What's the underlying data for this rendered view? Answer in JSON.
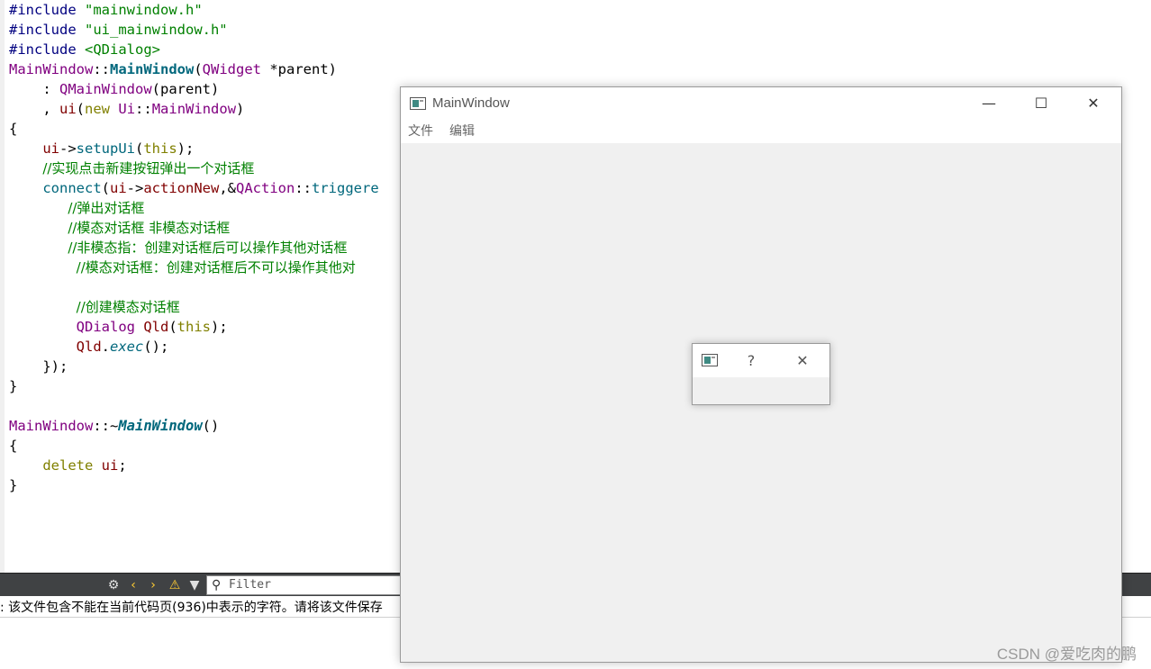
{
  "editor": {
    "lines": [
      [
        [
          "t-pp",
          "#include "
        ],
        [
          "t-str",
          "\"mainwindow.h\""
        ]
      ],
      [
        [
          "t-pp",
          "#include "
        ],
        [
          "t-str",
          "\"ui_mainwindow.h\""
        ]
      ],
      [
        [
          "t-pp",
          "#include "
        ],
        [
          "t-str",
          "<QDialog>"
        ]
      ],
      [
        [
          "t-cls",
          "MainWindow"
        ],
        [
          "t-def",
          "::"
        ],
        [
          "t-fnb",
          "MainWindow"
        ],
        [
          "t-def",
          "("
        ],
        [
          "t-cls",
          "QWidget"
        ],
        [
          "t-def",
          " *parent)"
        ]
      ],
      [
        [
          "t-def",
          "    : "
        ],
        [
          "t-cls",
          "QMainWindow"
        ],
        [
          "t-def",
          "(parent)"
        ]
      ],
      [
        [
          "t-def",
          "    , "
        ],
        [
          "t-var",
          "ui"
        ],
        [
          "t-def",
          "("
        ],
        [
          "t-kw",
          "new"
        ],
        [
          "t-def",
          " "
        ],
        [
          "t-cls",
          "Ui"
        ],
        [
          "t-def",
          "::"
        ],
        [
          "t-cls",
          "MainWindow"
        ],
        [
          "t-def",
          ")"
        ]
      ],
      [
        [
          "t-def",
          "{"
        ]
      ],
      [
        [
          "t-def",
          "    "
        ],
        [
          "t-var",
          "ui"
        ],
        [
          "t-def",
          "->"
        ],
        [
          "t-fn",
          "setupUi"
        ],
        [
          "t-def",
          "("
        ],
        [
          "t-kw",
          "this"
        ],
        [
          "t-def",
          ");"
        ]
      ],
      [
        [
          "t-def",
          "    "
        ],
        [
          "t-com",
          "//实现点击新建按钮弹出一个对话框"
        ]
      ],
      [
        [
          "t-def",
          "    "
        ],
        [
          "t-fn",
          "connect"
        ],
        [
          "t-def",
          "("
        ],
        [
          "t-var",
          "ui"
        ],
        [
          "t-def",
          "->"
        ],
        [
          "t-var",
          "actionNew"
        ],
        [
          "t-def",
          ",&"
        ],
        [
          "t-cls",
          "QAction"
        ],
        [
          "t-def",
          "::"
        ],
        [
          "t-fn",
          "triggere"
        ]
      ],
      [
        [
          "t-def",
          "       "
        ],
        [
          "t-com",
          "//弹出对话框"
        ]
      ],
      [
        [
          "t-def",
          "       "
        ],
        [
          "t-com",
          "//模态对话框 非模态对话框"
        ]
      ],
      [
        [
          "t-def",
          "       "
        ],
        [
          "t-com",
          "//非模态指：创建对话框后可以操作其他对话框"
        ]
      ],
      [
        [
          "t-def",
          "        "
        ],
        [
          "t-com",
          "//模态对话框：创建对话框后不可以操作其他对"
        ]
      ],
      [
        [
          "t-def",
          ""
        ]
      ],
      [
        [
          "t-def",
          "        "
        ],
        [
          "t-com",
          "//创建模态对话框"
        ]
      ],
      [
        [
          "t-def",
          "        "
        ],
        [
          "t-cls",
          "QDialog"
        ],
        [
          "t-def",
          " "
        ],
        [
          "t-var",
          "Qld"
        ],
        [
          "t-def",
          "("
        ],
        [
          "t-kw",
          "this"
        ],
        [
          "t-def",
          ");"
        ]
      ],
      [
        [
          "t-def",
          "        "
        ],
        [
          "t-var",
          "Qld"
        ],
        [
          "t-def",
          "."
        ],
        [
          "t-it",
          "exec"
        ],
        [
          "t-def",
          "();"
        ]
      ],
      [
        [
          "t-def",
          "    });"
        ]
      ],
      [
        [
          "t-def",
          "}"
        ]
      ],
      [
        [
          "t-def",
          ""
        ]
      ],
      [
        [
          "t-cls",
          "MainWindow"
        ],
        [
          "t-def",
          "::~"
        ],
        [
          "t-fni",
          "MainWindow"
        ],
        [
          "t-def",
          "()"
        ]
      ],
      [
        [
          "t-def",
          "{"
        ]
      ],
      [
        [
          "t-def",
          "    "
        ],
        [
          "t-kw",
          "delete"
        ],
        [
          "t-def",
          " "
        ],
        [
          "t-var",
          "ui"
        ],
        [
          "t-def",
          ";"
        ]
      ],
      [
        [
          "t-def",
          "}"
        ]
      ]
    ]
  },
  "issues_bar": {
    "filter_placeholder": "Filter",
    "message": ": 该文件包含不能在当前代码页(936)中表示的字符。请将该文件保存"
  },
  "main_window": {
    "title": "MainWindow",
    "minimize_glyph": "—",
    "maximize_glyph": "☐",
    "close_glyph": "✕",
    "menu": [
      {
        "label": "文件"
      },
      {
        "label": "编辑"
      }
    ]
  },
  "dialog": {
    "help_glyph": "?",
    "close_glyph": "✕"
  },
  "watermark": "CSDN @爱吃肉的鹏"
}
